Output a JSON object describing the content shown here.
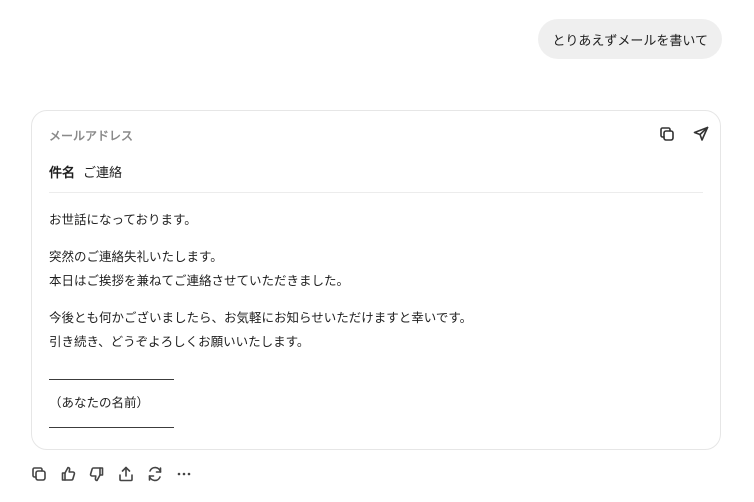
{
  "user_message": "とりあえずメールを書いて",
  "email": {
    "to_label": "メールアドレス",
    "subject_label": "件名",
    "subject_value": "ご連絡",
    "body": [
      [
        "お世話になっております。"
      ],
      [
        "突然のご連絡失礼いたします。",
        "本日はご挨拶を兼ねてご連絡させていただきました。"
      ],
      [
        "今後とも何かございましたら、お気軽にお知らせいただけますと幸いです。",
        "引き続き、どうぞよろしくお願いいたします。"
      ],
      [
        "――――――――――",
        "（あなたの名前）",
        "――――――――――"
      ]
    ]
  },
  "icons": {
    "card_actions": [
      "copy-icon",
      "send-icon"
    ],
    "bottom_actions": [
      "copy-icon",
      "thumbs-up-icon",
      "thumbs-down-icon",
      "share-icon",
      "regenerate-icon",
      "more-icon"
    ]
  },
  "colors": {
    "user_bubble_bg": "#efefef",
    "card_border": "#e6e6e6",
    "muted_text": "#8a8a8a"
  }
}
